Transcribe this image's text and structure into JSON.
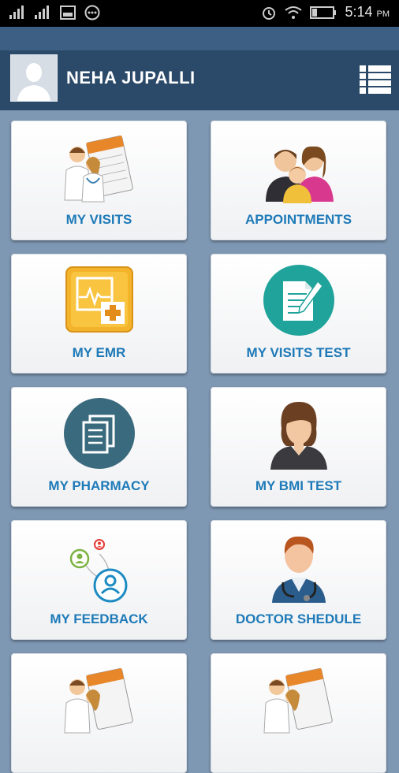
{
  "status_bar": {
    "time": "5:14",
    "ampm": "PM",
    "icons": [
      "signal-icon",
      "signal-icon",
      "image-icon",
      "chat-icon",
      "alarm-icon",
      "wifi-icon",
      "battery-icon"
    ]
  },
  "header": {
    "user_name": "NEHA JUPALLI",
    "avatar_icon": "person-silhouette-icon",
    "menu_icon": "list-menu-icon"
  },
  "tiles": [
    {
      "label": "MY VISITS",
      "icon": "doctor-calendar-icon"
    },
    {
      "label": "APPOINTMENTS",
      "icon": "family-icon"
    },
    {
      "label": "MY EMR",
      "icon": "medical-record-icon"
    },
    {
      "label": "MY VISITS TEST",
      "icon": "document-pen-icon"
    },
    {
      "label": "MY PHARMACY",
      "icon": "documents-icon"
    },
    {
      "label": "MY BMI TEST",
      "icon": "woman-avatar-icon"
    },
    {
      "label": "MY FEEDBACK",
      "icon": "feedback-users-icon"
    },
    {
      "label": "DOCTOR SHEDULE",
      "icon": "doctor-stethoscope-icon"
    },
    {
      "label": "",
      "icon": "doctor-calendar-icon"
    },
    {
      "label": "",
      "icon": "doctor-calendar-icon"
    }
  ],
  "colors": {
    "background": "#7e97b2",
    "header": "#2b4968",
    "label": "#1e7ab8",
    "teal": "#1fa39a",
    "dark_teal": "#3a6a7d"
  }
}
